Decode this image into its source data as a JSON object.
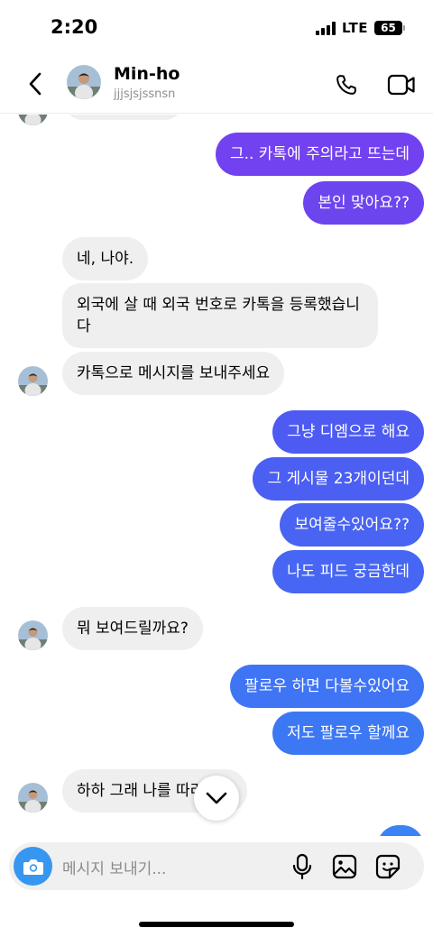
{
  "status_bar": {
    "time": "2:20",
    "network": "LTE",
    "battery": "65"
  },
  "header": {
    "name": "Min-ho",
    "username": "jjjsjsjssnsn"
  },
  "messages": [
    {
      "side": "sent",
      "text": "그.. 카톡에 주의라고 뜨는데",
      "color": "#7241f0"
    },
    {
      "side": "sent",
      "text": "본인 맞아요??",
      "color": "#6c45ef"
    },
    {
      "side": "received",
      "text": "네, 나야."
    },
    {
      "side": "received",
      "text": "외국에 살 때 외국 번호로 카톡을 등록했습니다"
    },
    {
      "side": "received",
      "text": "카톡으로 메시지를 보내주세요"
    },
    {
      "side": "sent",
      "text": "그냥 디엠으로 해요",
      "color": "#4d5bf2"
    },
    {
      "side": "sent",
      "text": "그 게시물 23개이던데",
      "color": "#4b5ff2"
    },
    {
      "side": "sent",
      "text": "보여줄수있어요??",
      "color": "#4963f2"
    },
    {
      "side": "sent",
      "text": "나도 피드 궁금한데",
      "color": "#4766f3"
    },
    {
      "side": "received",
      "text": "뭐 보여드릴까요?"
    },
    {
      "side": "sent",
      "text": "팔로우 하면 다볼수있어요",
      "color": "#3f74f4"
    },
    {
      "side": "sent",
      "text": "저도 팔로우 할께요",
      "color": "#3d78f4"
    },
    {
      "side": "received",
      "text": "하하 그래 나를 따라와요"
    }
  ],
  "composer": {
    "placeholder": "메시지 보내기..."
  },
  "colors": {
    "accent": "#3797f0",
    "received_bubble": "#efefef"
  }
}
